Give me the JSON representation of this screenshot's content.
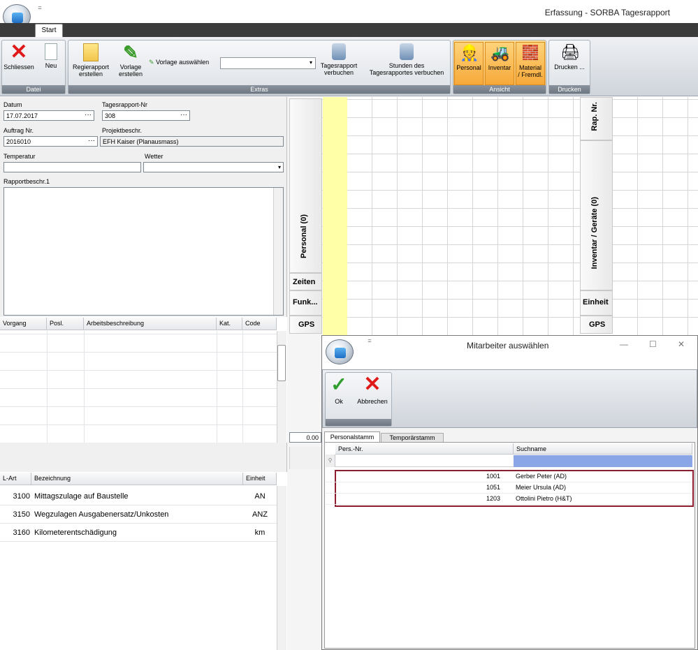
{
  "window": {
    "title": "Erfassung - SORBA Tagesrapport",
    "tab": "Start",
    "qat_glyph": "="
  },
  "ribbon": {
    "datei": {
      "label": "Datei",
      "schliessen": "Schliessen",
      "neu": "Neu"
    },
    "extras": {
      "label": "Extras",
      "regie_1": "Regierapport",
      "regie_2": "erstellen",
      "vorlage_1": "Vorlage",
      "vorlage_2": "erstellen",
      "vorlage_auswaehlen": "Vorlage auswählen",
      "combo_value": "",
      "tages_1": "Tagesrapport",
      "tages_2": "verbuchen",
      "stunden_1": "Stunden des",
      "stunden_2": "Tagesrapportes verbuchen"
    },
    "ansicht": {
      "label": "Ansicht",
      "personal": "Personal",
      "inventar": "Inventar",
      "material_1": "Material",
      "material_2": "/ Fremdl."
    },
    "drucken": {
      "label": "Drucken",
      "drucken": "Drucken ..."
    }
  },
  "form": {
    "datum_label": "Datum",
    "datum": "17.07.2017",
    "rapport_nr_label": "Tagesrapport-Nr",
    "rapport_nr": "308",
    "auftrag_label": "Auftrag Nr.",
    "auftrag": "2016010",
    "projekt_label": "Projektbeschr.",
    "projekt": "EFH Kaiser (Planausmass)",
    "temperatur_label": "Temperatur",
    "temperatur": "",
    "wetter_label": "Wetter",
    "wetter": "",
    "rapportbeschr_label": "Rapportbeschr.1",
    "rapportbeschr": "",
    "dots": "···"
  },
  "vorgang_table": {
    "headers": [
      "Vorgang",
      "Posl.",
      "Arbeitsbeschreibung",
      "Kat.",
      "Code"
    ]
  },
  "lart_table": {
    "headers": [
      "L-Art",
      "Bezeichnung",
      "Einheit"
    ],
    "rows": [
      {
        "lart": "3100",
        "bez": "Mittagszulage auf Baustelle",
        "einheit": "AN"
      },
      {
        "lart": "3150",
        "bez": "Wegzulagen Ausgabenersatz/Unkosten",
        "einheit": "ANZ"
      },
      {
        "lart": "3160",
        "bez": "Kilometerentschädigung",
        "einheit": "km"
      }
    ]
  },
  "personal_grid": {
    "header": "Personal (0)",
    "zeiten": "Zeiten",
    "funk": "Funk...",
    "gps": "GPS",
    "total": "0.00"
  },
  "inventar_grid": {
    "rap_nr": "Rap. Nr.",
    "header": "Inventar / Geräte (0)",
    "einheit": "Einheit",
    "gps": "GPS"
  },
  "dialog": {
    "title": "Mitarbeiter auswählen",
    "ok": "Ok",
    "abbrechen": "Abbrechen",
    "tabs": [
      "Personalstamm",
      "Temporärstamm"
    ],
    "headers": [
      "Pers.-Nr.",
      "Suchname"
    ],
    "rows": [
      {
        "nr": "1001",
        "name": "Gerber Peter (AD)"
      },
      {
        "nr": "1051",
        "name": "Meier Ursula (AD)"
      },
      {
        "nr": "1203",
        "name": "Ottolini Pietro (H&T)"
      }
    ],
    "min": "—",
    "max": "☐",
    "close": "✕"
  },
  "colors": {
    "accent_yellow": "#ffffa8",
    "selection_border": "#8c1c2e",
    "filter_blue": "#8aa6e6"
  }
}
